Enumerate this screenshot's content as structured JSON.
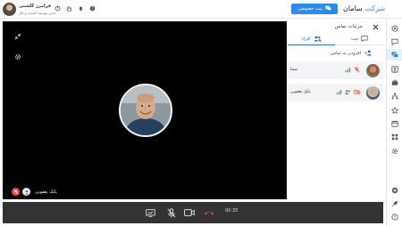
{
  "user": {
    "name": "فرامرز گلشنی",
    "role": "مدیر توسعه کسب و کار"
  },
  "header": {
    "private_label": "پیت خصوصی",
    "brand_prefix": "شرکت",
    "brand_name": "سامان",
    "accent_color": "#2e8ae6"
  },
  "top_icons": [
    "leave-icon",
    "hand-icon",
    "bell-icon",
    "help-icon"
  ],
  "rail_items": [
    "radio-icon",
    "chat-icon",
    "forum-icon",
    "contacts-icon",
    "briefcase-icon",
    "sitemap-icon",
    "star-icon",
    "calendar-icon",
    "grid-icon",
    "settings-icon",
    "add-icon",
    "rocket-icon",
    "help-icon"
  ],
  "call": {
    "participant_name": "بابک یعقوبی",
    "timer": "00:35"
  },
  "controls": [
    "screen-share-icon",
    "mic-off-icon",
    "camera-icon",
    "hangup-icon"
  ],
  "details": {
    "title": "جزئیات تماس",
    "tab_people": "افراد",
    "tab_chat": "چت",
    "add_label": "افزودن به تماس",
    "participants": [
      {
        "name": "شما"
      },
      {
        "name": "بابک یعقوبی"
      }
    ]
  }
}
